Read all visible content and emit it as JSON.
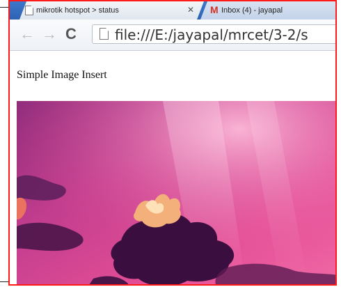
{
  "browser": {
    "tabs": [
      {
        "title": "mikrotik hotspot > status",
        "active": true
      },
      {
        "title": "Inbox (4) - jayapal",
        "active": false
      }
    ],
    "address": "file:///E:/jayapal/mrcet/3-2/s"
  },
  "page": {
    "heading": "Simple Image Insert"
  },
  "colors": {
    "frame": "#ff1a1a",
    "tabstrip": "#2d62b3"
  },
  "icons": [
    "document-icon",
    "gmail-icon",
    "close-icon",
    "back-icon",
    "forward-icon",
    "reload-icon"
  ]
}
